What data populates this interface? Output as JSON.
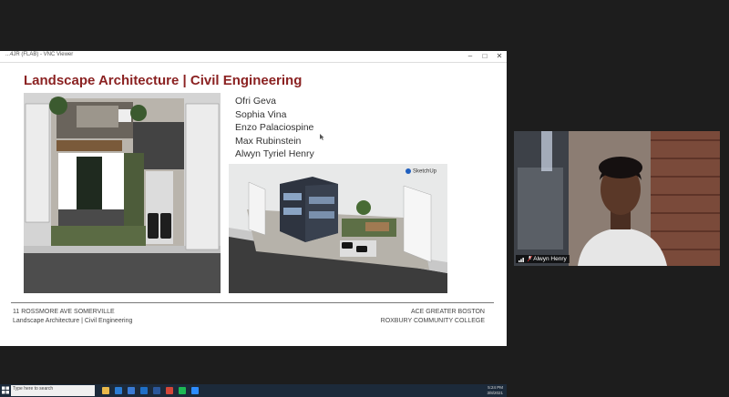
{
  "window": {
    "title": "...4JR (FLAB) - VNC Viewer",
    "minimize": "–",
    "maximize": "□",
    "close": "✕"
  },
  "slide": {
    "title": "Landscape Architecture | Civil Engineering",
    "names": [
      "Ofri Geva",
      "Sophia Vina",
      "Enzo Palaciospine",
      "Max Rubinstein",
      "Alwyn Tyriel Henry"
    ],
    "sketchup_label": "SketchUp",
    "footer_left_1": "11 ROSSMORE AVE SOMERVILLE",
    "footer_left_2": "Landscape Architecture | Civil Engineering",
    "footer_right_1": "ACE GREATER BOSTON",
    "footer_right_2": "ROXBURY COMMUNITY COLLEGE"
  },
  "taskbar": {
    "search_placeholder": "Type here to search",
    "time": "5:24 PM",
    "date": "3/8/2021",
    "icons": [
      "file-explorer-icon",
      "edge-icon",
      "store-icon",
      "mail-icon",
      "word-icon",
      "chrome-icon",
      "spotify-icon",
      "zoom-icon"
    ],
    "icon_colors": [
      "#e8b84a",
      "#2b7cd3",
      "#3a7bd5",
      "#1e6fc7",
      "#2b579a",
      "#d44638",
      "#1db954",
      "#2d8cff"
    ]
  },
  "video": {
    "participant_name": "Alwyn Henry",
    "mic_icon": "microphone-muted-icon"
  }
}
